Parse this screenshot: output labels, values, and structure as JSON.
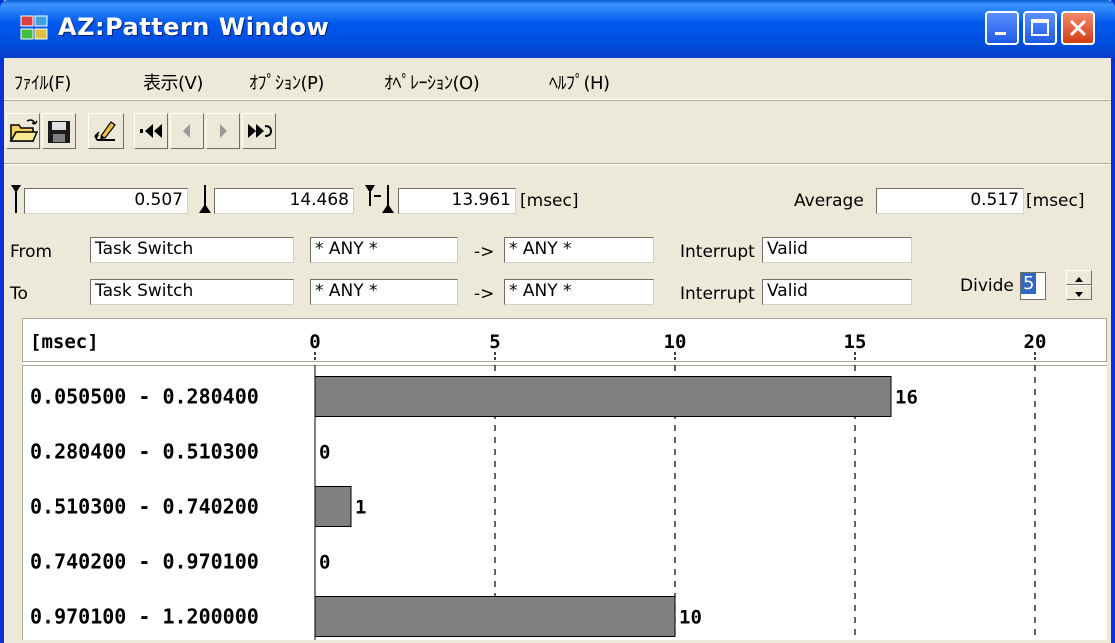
{
  "window": {
    "title": "AZ:Pattern Window"
  },
  "menu": {
    "items": [
      "ﾌｧｲﾙ(F)",
      "表示(V)",
      "ｵﾌﾟｼｮﾝ(P)",
      "ｵﾍﾟﾚｰｼｮﾝ(O)",
      "ﾍﾙﾌﾟ(H)"
    ]
  },
  "toolbar": {
    "icons": [
      "open-folder-icon",
      "save-disk-icon",
      "edit-pencil-icon",
      "first-icon",
      "previous-icon",
      "next-icon",
      "last-icon"
    ]
  },
  "measure": {
    "start_value": "0.507",
    "end_value": "14.468",
    "diff_value": "13.961",
    "unit": "[msec]",
    "average_label": "Average",
    "average_value": "0.517",
    "average_unit": "[msec]"
  },
  "from": {
    "label": "From",
    "event": "Task Switch",
    "source": "* ANY *",
    "arrow": "->",
    "target": "* ANY *",
    "interrupt_label": "Interrupt",
    "interrupt_value": "Valid"
  },
  "to": {
    "label": "To",
    "event": "Task Switch",
    "source": "* ANY *",
    "arrow": "->",
    "target": "* ANY *",
    "interrupt_label": "Interrupt",
    "interrupt_value": "Valid"
  },
  "divide": {
    "label": "Divide",
    "value": "5"
  },
  "chart_data": {
    "type": "bar",
    "orientation": "horizontal",
    "unit_label": "[msec]",
    "categories": [
      "0.050500 - 0.280400",
      "0.280400 - 0.510300",
      "0.510300 - 0.740200",
      "0.740200 - 0.970100",
      "0.970100 - 1.200000"
    ],
    "values": [
      16,
      0,
      1,
      0,
      10
    ],
    "xticks": [
      0,
      5,
      10,
      15,
      20
    ],
    "xlim": [
      0,
      21.5
    ],
    "grid": "dashed-vertical",
    "bar_color": "#808080"
  },
  "colors": {
    "titlebar": "#0058ee",
    "face": "#ece9d8",
    "bar": "#808080",
    "selection": "#316ac5"
  }
}
